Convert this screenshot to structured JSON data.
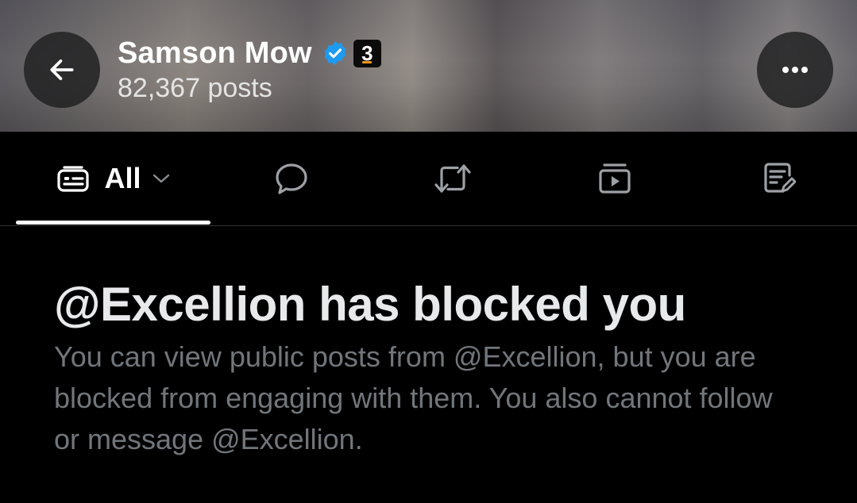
{
  "header": {
    "name": "Samson Mow",
    "verified_icon": "verified-badge-icon",
    "affiliation_badge": "3",
    "posts_count": "82,367 posts",
    "back_icon": "arrow-left-icon",
    "more_icon": "more-horizontal-icon"
  },
  "tabs": [
    {
      "label": "All",
      "icon": "timeline-icon",
      "selected": true,
      "has_dropdown": true
    },
    {
      "label": "",
      "icon": "reply-bubble-icon"
    },
    {
      "label": "",
      "icon": "repost-icon"
    },
    {
      "label": "",
      "icon": "media-play-icon"
    },
    {
      "label": "",
      "icon": "article-edit-icon"
    }
  ],
  "blocked": {
    "title": "@Excellion has blocked you",
    "body": "You can view public posts from @Excellion, but you are blocked from engaging with them. You also cannot follow or message @Excellion."
  },
  "colors": {
    "background": "#000000",
    "primary_text": "#e7e9ea",
    "secondary_text": "#71767b",
    "verified_blue": "#1d9bf0",
    "divider": "#2f3336"
  }
}
